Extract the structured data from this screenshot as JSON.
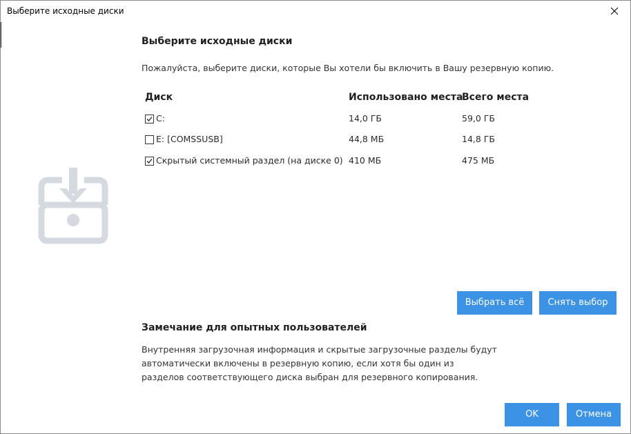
{
  "window": {
    "title": "Выберите исходные диски",
    "close_icon": "close-icon"
  },
  "illustration": {
    "icon": "chest-download-icon",
    "color": "#d5d9e0"
  },
  "main": {
    "heading": "Выберите исходные диски",
    "subtitle": "Пожалуйста, выберите диски, которые Вы хотели бы включить в Вашу резервную копию."
  },
  "table": {
    "columns": [
      "Диск",
      "Использовано места",
      "Всего места"
    ],
    "rows": [
      {
        "checked": true,
        "name": "C:",
        "used": "14,0 ГБ",
        "total": "59,0 ГБ"
      },
      {
        "checked": false,
        "name": "E: [COMSSUSB]",
        "used": "44,8 МБ",
        "total": "14,8 ГБ"
      },
      {
        "checked": true,
        "name": "Скрытый системный раздел (на диске 0)",
        "used": "410 МБ",
        "total": "475 МБ"
      }
    ]
  },
  "selection_buttons": {
    "select_all": "Выбрать всё",
    "deselect": "Снять выбор"
  },
  "note": {
    "heading": "Замечание для опытных пользователей",
    "lines": [
      "Внутренняя загрузочная информация и скрытые загрузочные разделы будут",
      "автоматически включены в резервную копию, если хотя бы один из",
      "разделов соответствующего диска выбран для резервного копирования."
    ]
  },
  "footer": {
    "ok": "OK",
    "cancel": "Отмена"
  },
  "colors": {
    "accent": "#3c93e6",
    "text": "#1f1f1f",
    "illustration": "#d5d9e0"
  }
}
